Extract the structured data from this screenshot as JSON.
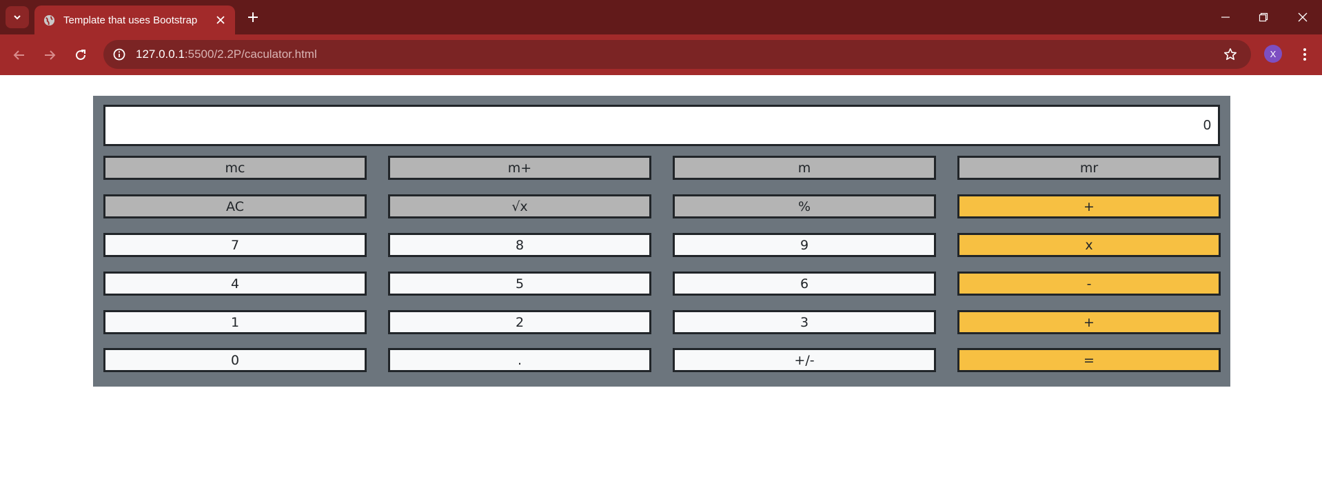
{
  "browser": {
    "tab_title": "Template that uses Bootstrap",
    "url_host": "127.0.0.1",
    "url_path": ":5500/2.2P/caculator.html",
    "profile_initial": "X"
  },
  "calculator": {
    "display_value": "0",
    "keys": [
      {
        "label": "mc",
        "style": "gray"
      },
      {
        "label": "m+",
        "style": "gray"
      },
      {
        "label": "m",
        "style": "gray"
      },
      {
        "label": "mr",
        "style": "gray"
      },
      {
        "label": "AC",
        "style": "gray"
      },
      {
        "label": "√x",
        "style": "gray"
      },
      {
        "label": "%",
        "style": "gray"
      },
      {
        "label": "+",
        "style": "yellow"
      },
      {
        "label": "7",
        "style": "white"
      },
      {
        "label": "8",
        "style": "white"
      },
      {
        "label": "9",
        "style": "white"
      },
      {
        "label": "x",
        "style": "yellow"
      },
      {
        "label": "4",
        "style": "white"
      },
      {
        "label": "5",
        "style": "white"
      },
      {
        "label": "6",
        "style": "white"
      },
      {
        "label": "-",
        "style": "yellow"
      },
      {
        "label": "1",
        "style": "white"
      },
      {
        "label": "2",
        "style": "white"
      },
      {
        "label": "3",
        "style": "white"
      },
      {
        "label": "+",
        "style": "yellow"
      },
      {
        "label": "0",
        "style": "white"
      },
      {
        "label": ".",
        "style": "white"
      },
      {
        "label": "+/-",
        "style": "white"
      },
      {
        "label": "=",
        "style": "yellow"
      }
    ]
  },
  "colors": {
    "tabbar": "#621a1a",
    "toolbar": "#a22a2a",
    "calc_panel": "#6c757d",
    "key_gray": "#b4b4b4",
    "key_white": "#f8f9fa",
    "key_yellow": "#f7c042"
  },
  "icons": [
    "tab-search-icon",
    "globe-icon",
    "close-icon",
    "plus-icon",
    "minimize-icon",
    "restore-icon",
    "back-icon",
    "forward-icon",
    "reload-icon",
    "info-icon",
    "star-icon",
    "more-icon"
  ]
}
